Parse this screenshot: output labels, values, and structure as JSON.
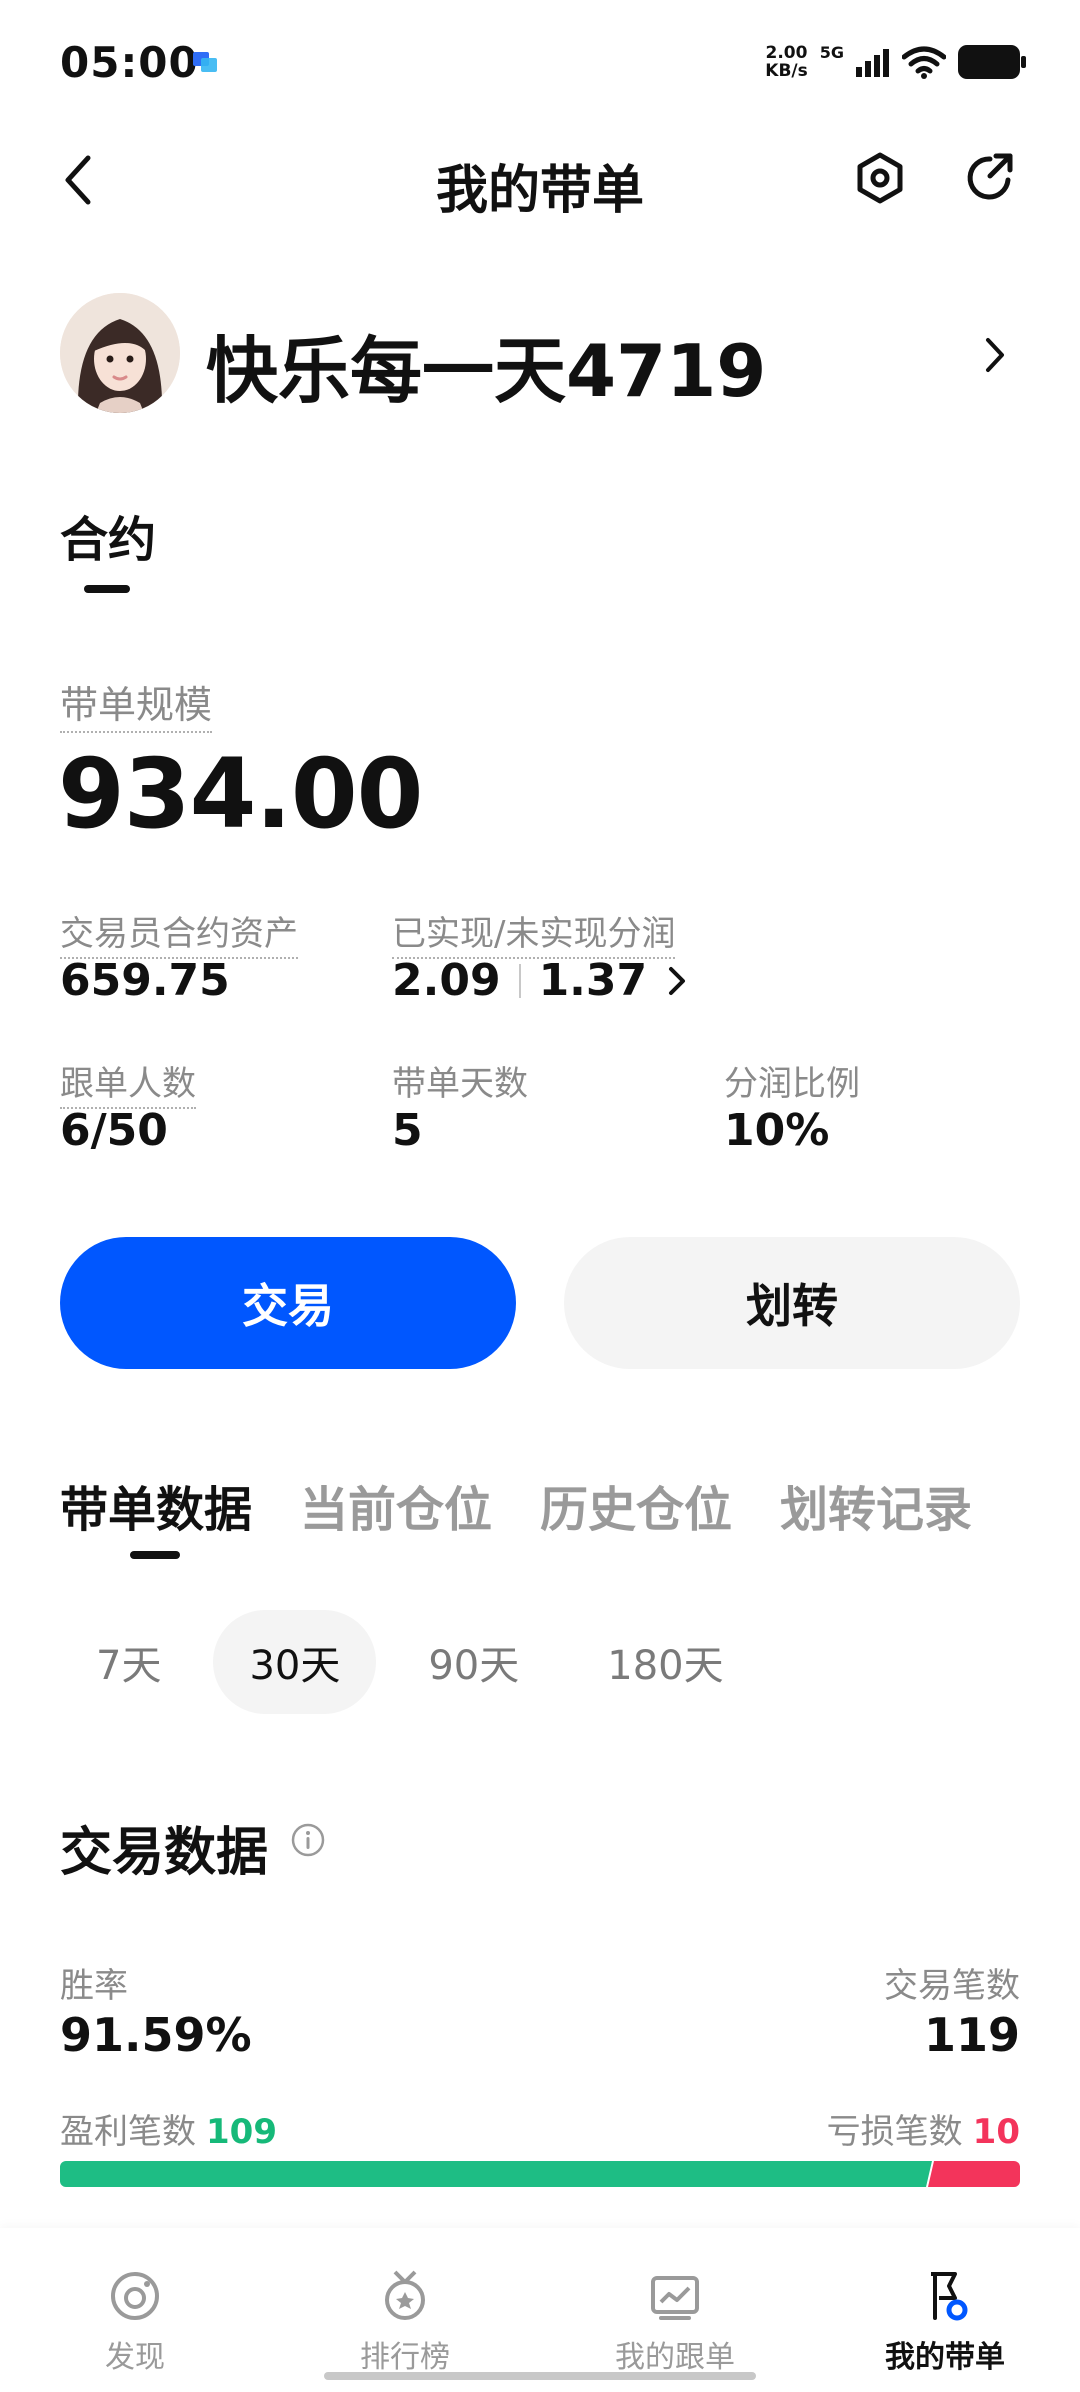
{
  "status_bar": {
    "time": "05:00",
    "net_speed_value": "2.00",
    "net_speed_unit": "KB/s",
    "network": "5G"
  },
  "nav": {
    "title": "我的带单"
  },
  "profile": {
    "username": "快乐每一天4719"
  },
  "section_tab": {
    "label": "合约"
  },
  "summary": {
    "scale_label": "带单规模",
    "scale_value": "934.00",
    "trader_assets_label": "交易员合约资产",
    "trader_assets_value": "659.75",
    "profit_share_label": "已实现/未实现分润",
    "realized_value": "2.09",
    "unrealized_value": "1.37",
    "followers_label": "跟单人数",
    "followers_value": "6/50",
    "days_label": "带单天数",
    "days_value": "5",
    "ratio_label": "分润比例",
    "ratio_value": "10%"
  },
  "actions": {
    "trade_label": "交易",
    "transfer_label": "划转"
  },
  "data_tabs": [
    "带单数据",
    "当前仓位",
    "历史仓位",
    "划转记录"
  ],
  "periods": [
    "7天",
    "30天",
    "90天",
    "180天"
  ],
  "active_period": "30天",
  "trade_data": {
    "title": "交易数据",
    "win_rate_label": "胜率",
    "win_rate_value": "91.59%",
    "trade_count_label": "交易笔数",
    "trade_count_value": "119",
    "profit_count_label": "盈利笔数",
    "profit_count_value": "109",
    "loss_count_label": "亏损笔数",
    "loss_count_value": "10",
    "profit_color": "#1ebd84",
    "loss_color": "#f3345b"
  },
  "bottom_nav": {
    "items": [
      {
        "label": "发现",
        "icon": "discover-icon"
      },
      {
        "label": "排行榜",
        "icon": "medal-icon"
      },
      {
        "label": "我的跟单",
        "icon": "chart-board-icon"
      },
      {
        "label": "我的带单",
        "icon": "flag-person-icon"
      }
    ],
    "active_index": 3
  },
  "colors": {
    "primary": "#0057ff",
    "text": "#111111",
    "muted": "#8a8a8a"
  }
}
